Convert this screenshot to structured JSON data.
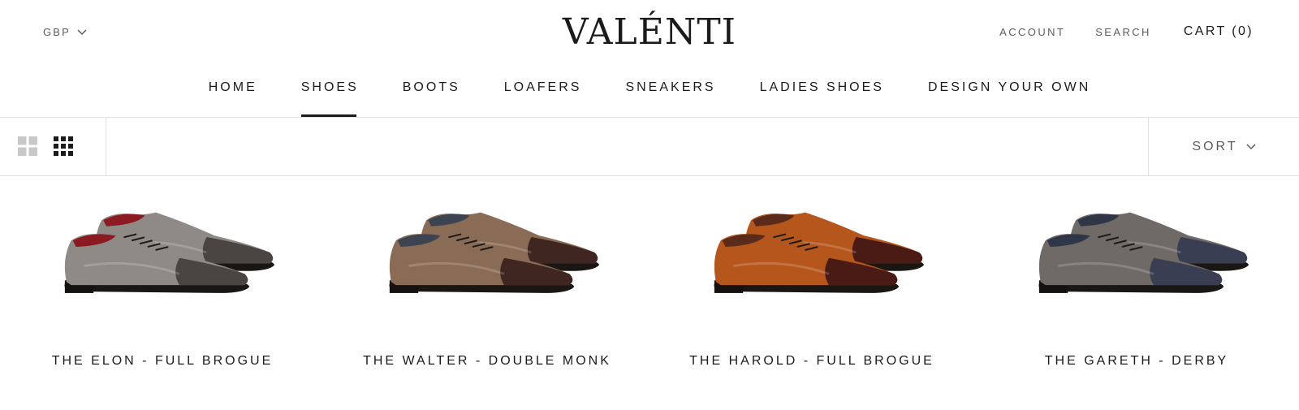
{
  "header": {
    "currency": "GBP",
    "logo": "VALÉNTI",
    "account": "ACCOUNT",
    "search": "SEARCH",
    "cart": "CART (0)"
  },
  "nav": {
    "items": [
      {
        "label": "HOME",
        "active": false
      },
      {
        "label": "SHOES",
        "active": true
      },
      {
        "label": "BOOTS",
        "active": false
      },
      {
        "label": "LOAFERS",
        "active": false
      },
      {
        "label": "SNEAKERS",
        "active": false
      },
      {
        "label": "LADIES SHOES",
        "active": false
      },
      {
        "label": "DESIGN YOUR OWN",
        "active": false
      }
    ]
  },
  "toolbar": {
    "sort_label": "SORT",
    "icons": [
      "grid-2-icon",
      "grid-3-icon",
      "chevron-down-icon"
    ],
    "active_layout": "grid-3"
  },
  "products": [
    {
      "title": "THE ELON - FULL BROGUE",
      "image": "shoe-grey-brogue-image",
      "colors": {
        "upper": "#8f8a85",
        "toe": "#4a4442",
        "lining": "#8b1a22"
      }
    },
    {
      "title": "THE WALTER - DOUBLE MONK",
      "image": "shoe-brown-monk-image",
      "colors": {
        "upper": "#8a6b55",
        "toe": "#3f2621",
        "lining": "#3c4452"
      }
    },
    {
      "title": "THE HAROLD - FULL BROGUE",
      "image": "shoe-tan-brogue-image",
      "colors": {
        "upper": "#b5561c",
        "toe": "#4a1a14",
        "lining": "#5a2a1a"
      }
    },
    {
      "title": "THE GARETH - DERBY",
      "image": "shoe-navy-derby-image",
      "colors": {
        "upper": "#6f6a66",
        "toe": "#3a3e52",
        "lining": "#2f3648"
      }
    }
  ]
}
